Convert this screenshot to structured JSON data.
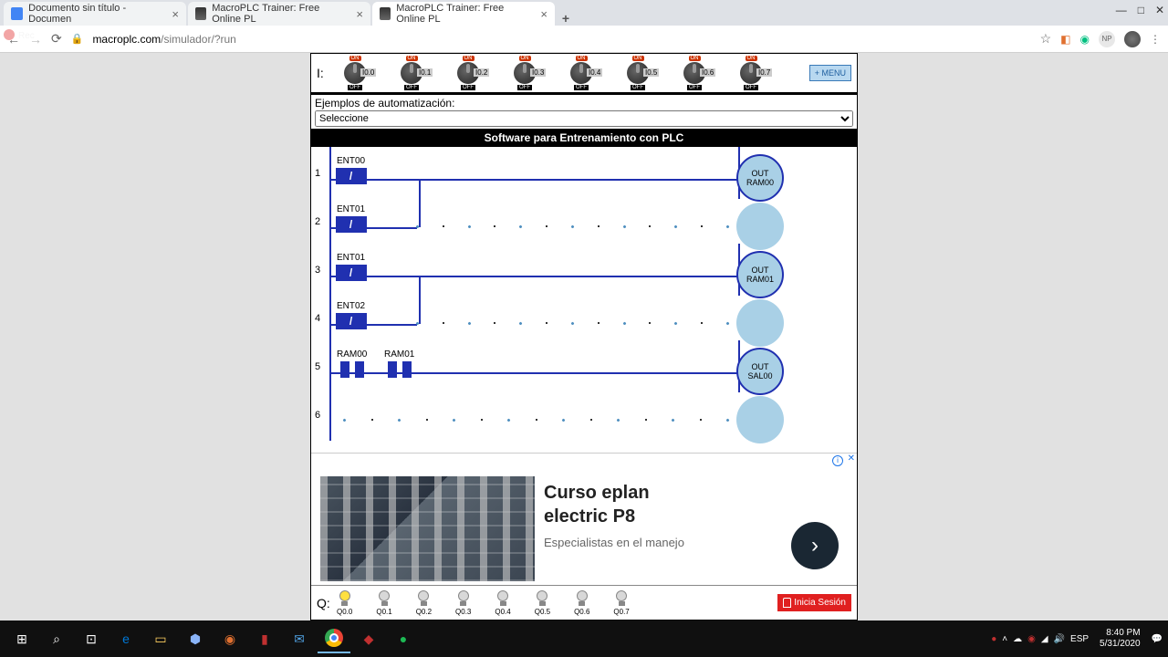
{
  "browser": {
    "tabs": [
      {
        "title": "Documento sin título - Documen"
      },
      {
        "title": "MacroPLC Trainer: Free Online PL"
      },
      {
        "title": "MacroPLC Trainer: Free Online PL"
      }
    ],
    "url_domain": "macroplc.com",
    "url_path": "/simulador/?run",
    "np": "NP"
  },
  "window": {
    "min": "—",
    "max": "□",
    "close": "✕"
  },
  "rec": "Rec",
  "io": {
    "i_label": "I:",
    "switches": [
      "I0.0",
      "I0.1",
      "I0.2",
      "I0.3",
      "I0.4",
      "I0.5",
      "I0.6",
      "I0.7"
    ],
    "on": "ON",
    "off": "OFF",
    "menu": "+ MENU"
  },
  "examples": {
    "label": "Ejemplos de automatización:",
    "placeholder": "Seleccione"
  },
  "title": "Software para Entrenamiento con PLC",
  "ladder": {
    "rungs": [
      {
        "n": "1",
        "el": "ENT00",
        "coil_top": "OUT",
        "coil_bot": "RAM00"
      },
      {
        "n": "2",
        "el": "ENT01"
      },
      {
        "n": "3",
        "el": "ENT01",
        "coil_top": "OUT",
        "coil_bot": "RAM01"
      },
      {
        "n": "4",
        "el": "ENT02"
      },
      {
        "n": "5",
        "el1": "RAM00",
        "el2": "RAM01",
        "coil_top": "OUT",
        "coil_bot": "SAL00"
      },
      {
        "n": "6"
      }
    ]
  },
  "ad": {
    "info": "i",
    "close": "✕",
    "h1": "Curso eplan",
    "h2": "electric P8",
    "sub": "Especialistas en el manejo",
    "arrow": "›"
  },
  "q": {
    "label": "Q:",
    "bulbs": [
      "Q0.0",
      "Q0.1",
      "Q0.2",
      "Q0.3",
      "Q0.4",
      "Q0.5",
      "Q0.6",
      "Q0.7"
    ],
    "session": "Inicia Sesión"
  },
  "tray": {
    "lang": "ESP",
    "time": "8:40 PM",
    "date": "5/31/2020"
  }
}
